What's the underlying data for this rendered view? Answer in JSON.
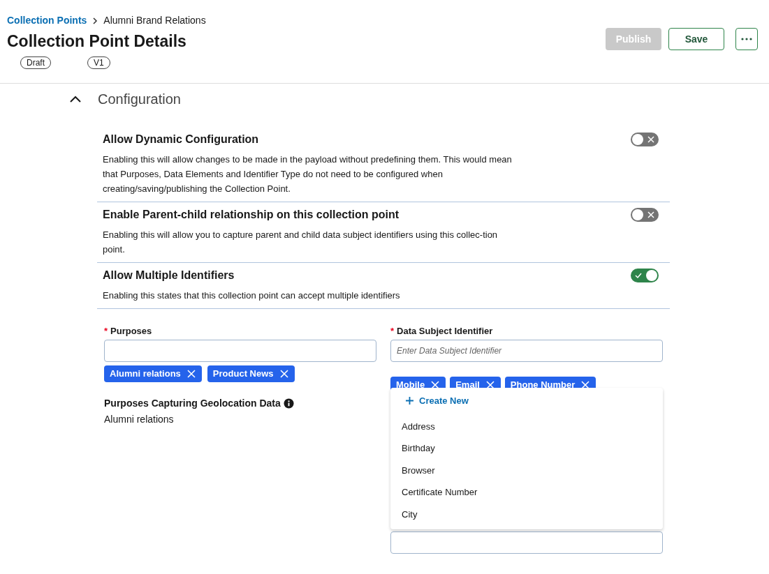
{
  "breadcrumb": {
    "link": "Collection Points",
    "current": "Alumni Brand Relations"
  },
  "title": "Collection Point Details",
  "badges": [
    "Draft",
    "V1"
  ],
  "actions": {
    "publish": {
      "label": "Publish",
      "disabled": true
    },
    "save": {
      "label": "Save",
      "disabled": false
    }
  },
  "section": {
    "title": "Configuration",
    "expanded": true
  },
  "settings": [
    {
      "title": "Allow Dynamic Configuration",
      "description": "Enabling this will allow changes to be made in the payload without predefining them. This would mean that Purposes, Data Elements and Identifier Type do not need to be configured when creating/saving/publishing the Collection Point.",
      "on": false
    },
    {
      "title": "Enable Parent-child relationship on this collection point",
      "description": "Enabling this will allow you to capture parent and child data subject identifiers using this collec-tion point.",
      "on": false
    },
    {
      "title": "Allow Multiple Identifiers",
      "description": "Enabling this states that this collection point can accept multiple identifiers",
      "on": true
    }
  ],
  "purposes": {
    "label": "Purposes",
    "required_mark": "*",
    "tags": [
      "Alumni relations",
      "Product News"
    ]
  },
  "geolocation": {
    "label": "Purposes Capturing Geolocation Data",
    "value": "Alumni relations"
  },
  "identifier": {
    "label": "Data Subject Identifier",
    "required_mark": "*",
    "placeholder": "Enter Data Subject Identifier",
    "tags": [
      "Mobile",
      "Email",
      "Phone Number"
    ],
    "dropdown": {
      "create": "Create New",
      "options": [
        "Address",
        "Birthday",
        "Browser",
        "Certificate Number",
        "City"
      ]
    }
  }
}
